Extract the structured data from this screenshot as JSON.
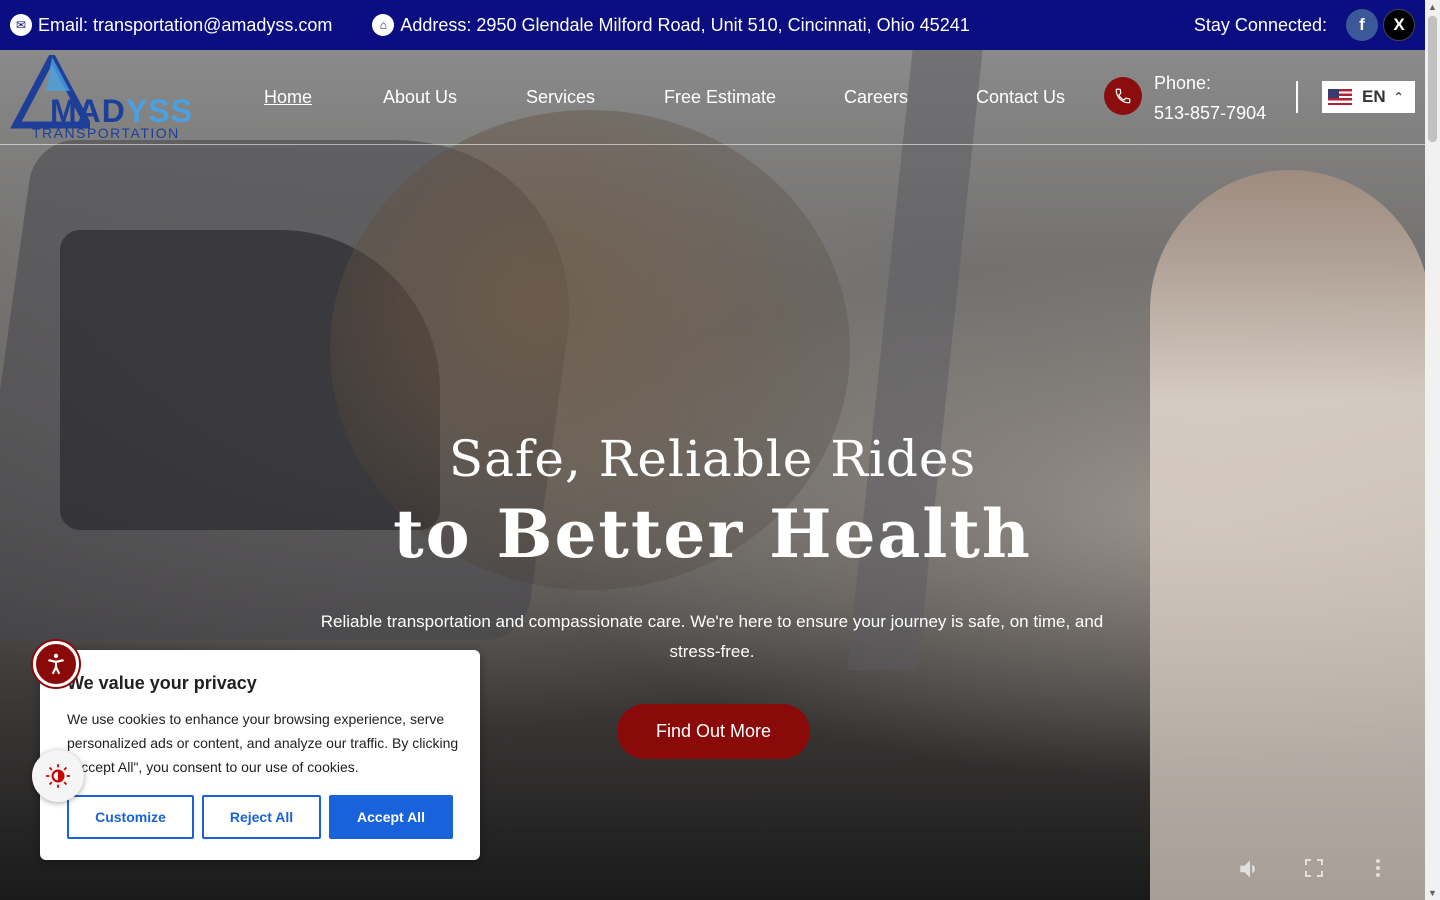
{
  "topbar": {
    "email": "Email: transportation@amadyss.com",
    "address": "Address: 2950 Glendale Milford Road, Unit 510, Cincinnati, Ohio 45241",
    "stay_connected": "Stay Connected:",
    "facebook_icon": "f",
    "x_icon": "X"
  },
  "logo": {
    "word_a": "",
    "word_main": "MAD",
    "word_accent": "YSS",
    "sub": "TRANSPORTATION"
  },
  "nav": {
    "items": [
      {
        "label": "Home"
      },
      {
        "label": "About Us"
      },
      {
        "label": "Services"
      },
      {
        "label": "Free Estimate"
      },
      {
        "label": "Careers"
      },
      {
        "label": "Contact Us"
      }
    ],
    "phone_label": "Phone:",
    "phone_number": "513-857-7904",
    "language": "EN"
  },
  "hero": {
    "title_line1": "Safe, Reliable Rides",
    "title_line2": "to Better Health",
    "subtitle": "Reliable transportation and compassionate care. We're here to ensure your journey is safe, on time, and stress-free.",
    "cta": "Find Out More"
  },
  "cookie": {
    "title": "We value your privacy",
    "body": "We use cookies to enhance your browsing experience, serve personalized ads or content, and analyze our traffic. By clicking \"Accept All\", you consent to our use of cookies.",
    "customize": "Customize",
    "reject": "Reject All",
    "accept": "Accept All"
  },
  "colors": {
    "topbar": "#0b0e80",
    "brand_red": "#8a0a0a",
    "cookie_blue": "#1863dc"
  }
}
